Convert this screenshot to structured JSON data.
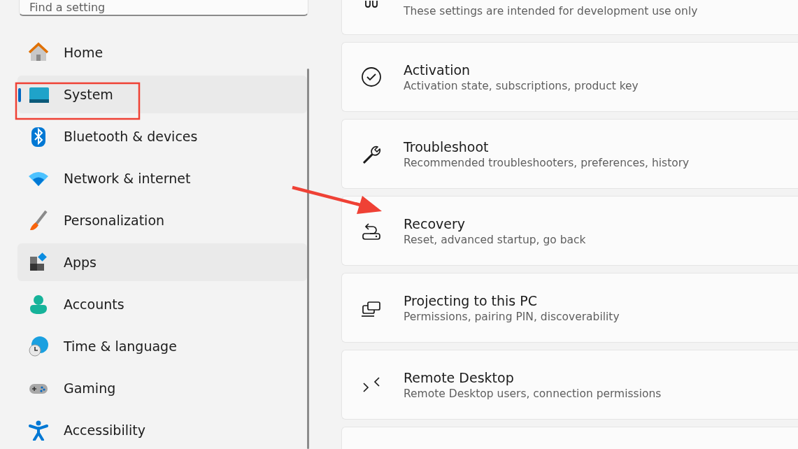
{
  "search": {
    "placeholder": "Find a setting"
  },
  "sidebar": {
    "items": [
      {
        "label": "Home",
        "selected": false,
        "hovered": false
      },
      {
        "label": "System",
        "selected": true,
        "hovered": false
      },
      {
        "label": "Bluetooth & devices",
        "selected": false,
        "hovered": false
      },
      {
        "label": "Network & internet",
        "selected": false,
        "hovered": false
      },
      {
        "label": "Personalization",
        "selected": false,
        "hovered": false
      },
      {
        "label": "Apps",
        "selected": false,
        "hovered": true
      },
      {
        "label": "Accounts",
        "selected": false,
        "hovered": false
      },
      {
        "label": "Time & language",
        "selected": false,
        "hovered": false
      },
      {
        "label": "Gaming",
        "selected": false,
        "hovered": false
      },
      {
        "label": "Accessibility",
        "selected": false,
        "hovered": false
      }
    ]
  },
  "settings": [
    {
      "kind": "partial",
      "subtitle": "These settings are intended for development use only"
    },
    {
      "kind": "full",
      "title": "Activation",
      "subtitle": "Activation state, subscriptions, product key"
    },
    {
      "kind": "full",
      "title": "Troubleshoot",
      "subtitle": "Recommended troubleshooters, preferences, history"
    },
    {
      "kind": "full",
      "title": "Recovery",
      "subtitle": "Reset, advanced startup, go back"
    },
    {
      "kind": "full",
      "title": "Projecting to this PC",
      "subtitle": "Permissions, pairing PIN, discoverability"
    },
    {
      "kind": "full",
      "title": "Remote Desktop",
      "subtitle": "Remote Desktop users, connection permissions"
    },
    {
      "kind": "empty"
    }
  ]
}
